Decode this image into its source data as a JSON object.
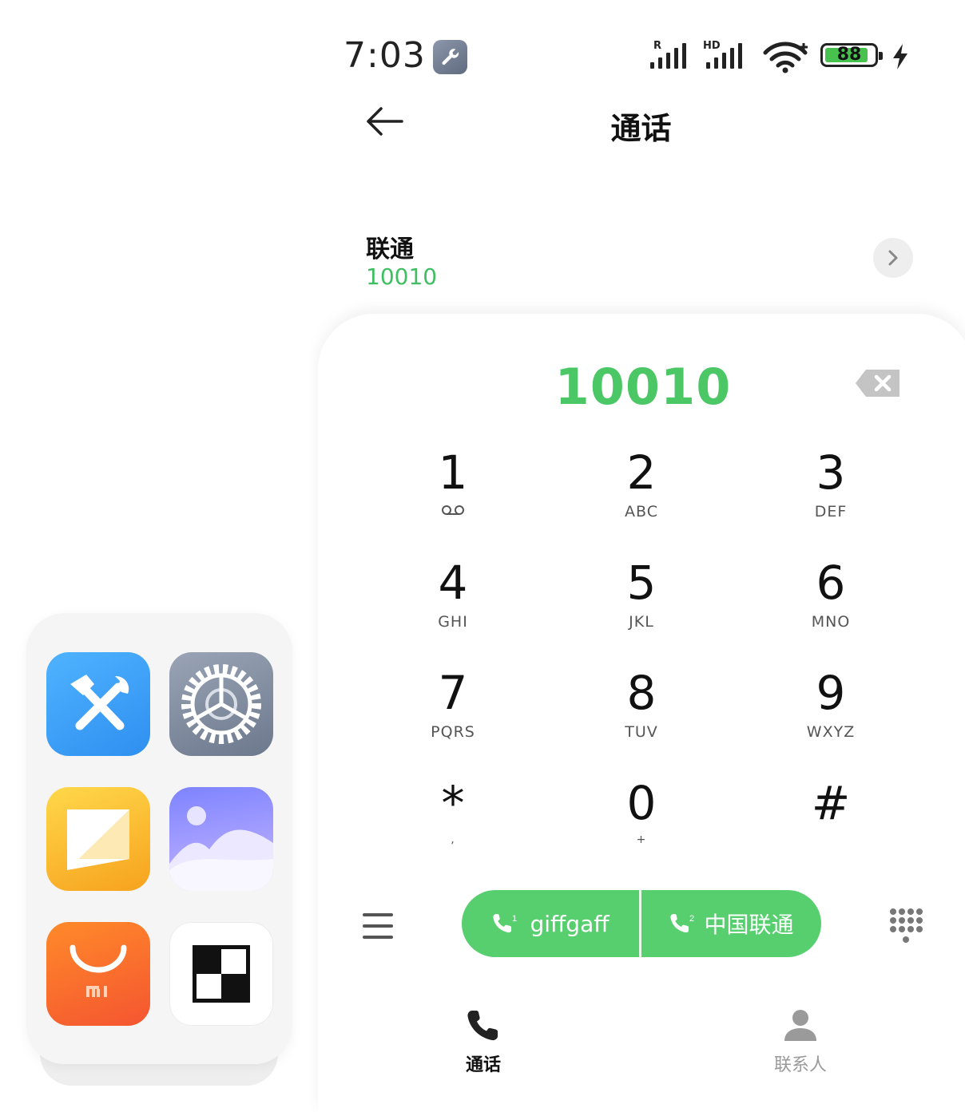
{
  "status_bar": {
    "time": "7:03",
    "roaming_tag": "R",
    "hd_tag": "HD",
    "battery_level": 88,
    "battery_text": "88",
    "icons": [
      "wrench-icon",
      "signal-icon",
      "signal-icon",
      "wifi-icon",
      "battery-icon",
      "charging-icon"
    ]
  },
  "header": {
    "title": "通话"
  },
  "suggestion": {
    "name": "联通",
    "number": "10010"
  },
  "dialer": {
    "input_value": "10010",
    "keys": [
      {
        "digit": "1",
        "letters": ""
      },
      {
        "digit": "2",
        "letters": "ABC"
      },
      {
        "digit": "3",
        "letters": "DEF"
      },
      {
        "digit": "4",
        "letters": "GHI"
      },
      {
        "digit": "5",
        "letters": "JKL"
      },
      {
        "digit": "6",
        "letters": "MNO"
      },
      {
        "digit": "7",
        "letters": "PQRS"
      },
      {
        "digit": "8",
        "letters": "TUV"
      },
      {
        "digit": "9",
        "letters": "WXYZ"
      },
      {
        "digit": "*",
        "letters": ","
      },
      {
        "digit": "0",
        "letters": "+"
      },
      {
        "digit": "#",
        "letters": ""
      }
    ]
  },
  "call_buttons": {
    "sim1": {
      "label": "giffgaff",
      "sim_index": "1"
    },
    "sim2": {
      "label": "中国联通",
      "sim_index": "2"
    }
  },
  "tabs": [
    {
      "label": "通话",
      "active": true
    },
    {
      "label": "联系人",
      "active": false
    }
  ],
  "colors": {
    "accent_green": "#4cc766",
    "pill_green": "#58cf6f",
    "tab_inactive": "#9a9a9a"
  }
}
